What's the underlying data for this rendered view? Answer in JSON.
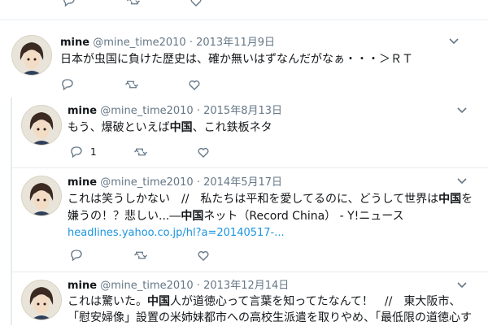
{
  "accent_link": "#1b95e0",
  "tweets": [
    {
      "name": "mine",
      "handle": "@mine_time2010",
      "dot": "·",
      "date": "2013年11月9日",
      "lines": [
        "日本が虫国に負けた歴史は、確か無いはずなんだがなぁ・・・＞ＲＴ"
      ],
      "reply_count": ""
    },
    {
      "name": "mine",
      "handle": "@mine_time2010",
      "dot": "·",
      "date": "2015年8月13日",
      "text_pre": "もう、爆破といえば",
      "text_bold": "中国",
      "text_post": "、これ鉄板ネタ",
      "reply_count": "1"
    },
    {
      "name": "mine",
      "handle": "@mine_time2010",
      "dot": "·",
      "date": "2014年5月17日",
      "line1_pre": "これは笑うしかない　//　私たちは平和を愛してるのに、どうして世界は",
      "line1_bold": "中国",
      "line1_post": "を",
      "line2_pre": "嫌うの！？悲しい...―",
      "line2_bold": "中国",
      "line2_post": "ネット（Record China） - Y!ニュース",
      "link": "headlines.yahoo.co.jp/hl?a=20140517-...",
      "reply_count": ""
    },
    {
      "name": "mine",
      "handle": "@mine_time2010",
      "dot": "·",
      "date": "2013年12月14日",
      "line1_pre": "これは驚いた。",
      "line1_bold": "中国",
      "line1_post": "人が道徳心って言葉を知ってたなんて！　//　東大阪市、",
      "line2": "「慰安婦像」設置の米姉妹都市への高校生派遣を取りやめ、「最低限の道徳心す",
      "reply_count": ""
    }
  ],
  "icons": [
    "reply-icon",
    "retweet-icon",
    "like-icon",
    "chevron-down-icon"
  ]
}
